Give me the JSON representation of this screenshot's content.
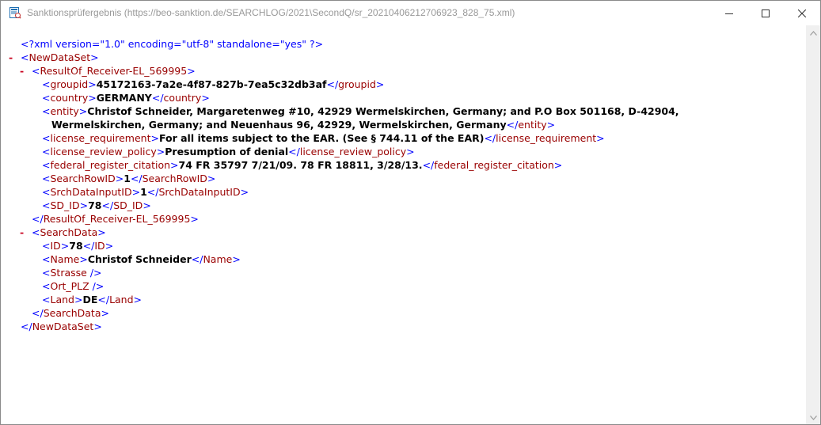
{
  "window": {
    "title": "Sanktionsprüfergebnis (https://beo-sanktion.de/SEARCHLOG/2021\\SecondQ/sr_20210406212706923_828_75.xml)",
    "app_icon": "document-report-icon"
  },
  "controls": {
    "minimize_icon": "minimize-icon",
    "maximize_icon": "maximize-icon",
    "close_icon": "close-icon"
  },
  "xml": {
    "declaration": "<?xml version=\"1.0\" encoding=\"utf-8\" standalone=\"yes\" ?>",
    "toggle": "-",
    "root_tag": "NewDataSet",
    "result_tag": "ResultOf_Receiver-EL_569995",
    "fields": [
      {
        "tag": "groupid",
        "value": "45172163-7a2e-4f87-827b-7ea5c32db3af"
      },
      {
        "tag": "country",
        "value": "GERMANY"
      },
      {
        "tag": "entity",
        "value": "Christof Schneider, Margaretenweg #10, 42929 Wermelskirchen, Germany; and P.O Box 501168, D-42904,",
        "value_cont": "Wermelskirchen, Germany; and Neuenhaus 96, 42929, Wermelskirchen, Germany"
      },
      {
        "tag": "license_requirement",
        "value": "For all items subject to the EAR. (See § 744.11 of the EAR)"
      },
      {
        "tag": "license_review_policy",
        "value": "Presumption of denial"
      },
      {
        "tag": "federal_register_citation",
        "value": "74 FR 35797 7/21/09. 78 FR 18811, 3/28/13."
      },
      {
        "tag": "SearchRowID",
        "value": "1"
      },
      {
        "tag": "SrchDataInputID",
        "value": "1"
      },
      {
        "tag": "SD_ID",
        "value": "78"
      }
    ],
    "search_tag": "SearchData",
    "search_fields": [
      {
        "tag": "ID",
        "value": "78"
      },
      {
        "tag": "Name",
        "value": "Christof Schneider"
      },
      {
        "tag": "Strasse",
        "empty": true
      },
      {
        "tag": "Ort_PLZ",
        "empty": true
      },
      {
        "tag": "Land",
        "value": "DE"
      }
    ]
  },
  "scrollbar": {
    "up_icon": "chevron-up-icon",
    "down_icon": "chevron-down-icon"
  }
}
